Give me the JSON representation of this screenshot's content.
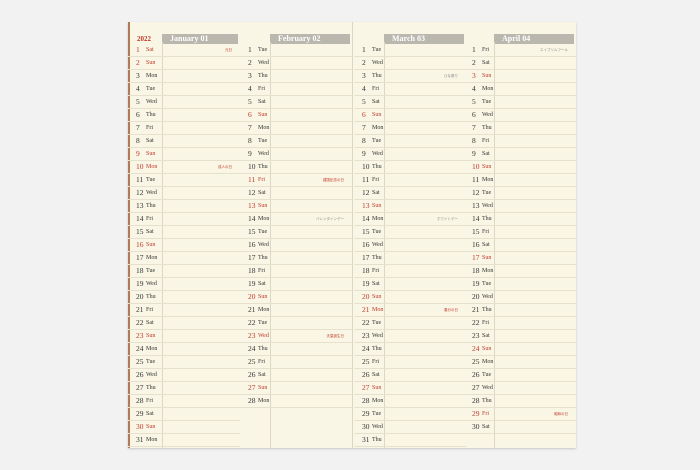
{
  "year": "2022",
  "colors": {
    "red": "#c0392b",
    "header_gray": "#b9b7ae",
    "paper": "#f9f6e5",
    "binding": "#b07b58"
  },
  "months": [
    {
      "title": "January 01",
      "days": [
        {
          "d": "1",
          "w": "Sat",
          "red": true,
          "note": "元日"
        },
        {
          "d": "2",
          "w": "Sun",
          "red": true
        },
        {
          "d": "3",
          "w": "Mon"
        },
        {
          "d": "4",
          "w": "Tue"
        },
        {
          "d": "5",
          "w": "Wed"
        },
        {
          "d": "6",
          "w": "Thu"
        },
        {
          "d": "7",
          "w": "Fri"
        },
        {
          "d": "8",
          "w": "Sat"
        },
        {
          "d": "9",
          "w": "Sun",
          "red": true
        },
        {
          "d": "10",
          "w": "Mon",
          "red": true,
          "note": "成人の日"
        },
        {
          "d": "11",
          "w": "Tue"
        },
        {
          "d": "12",
          "w": "Wed"
        },
        {
          "d": "13",
          "w": "Thu"
        },
        {
          "d": "14",
          "w": "Fri"
        },
        {
          "d": "15",
          "w": "Sat"
        },
        {
          "d": "16",
          "w": "Sun",
          "red": true
        },
        {
          "d": "17",
          "w": "Mon"
        },
        {
          "d": "18",
          "w": "Tue"
        },
        {
          "d": "19",
          "w": "Wed"
        },
        {
          "d": "20",
          "w": "Thu"
        },
        {
          "d": "21",
          "w": "Fri"
        },
        {
          "d": "22",
          "w": "Sat"
        },
        {
          "d": "23",
          "w": "Sun",
          "red": true
        },
        {
          "d": "24",
          "w": "Mon"
        },
        {
          "d": "25",
          "w": "Tue"
        },
        {
          "d": "26",
          "w": "Wed"
        },
        {
          "d": "27",
          "w": "Thu"
        },
        {
          "d": "28",
          "w": "Fri"
        },
        {
          "d": "29",
          "w": "Sat"
        },
        {
          "d": "30",
          "w": "Sun",
          "red": true
        },
        {
          "d": "31",
          "w": "Mon"
        }
      ]
    },
    {
      "title": "February 02",
      "days": [
        {
          "d": "1",
          "w": "Tue"
        },
        {
          "d": "2",
          "w": "Wed"
        },
        {
          "d": "3",
          "w": "Thu"
        },
        {
          "d": "4",
          "w": "Fri"
        },
        {
          "d": "5",
          "w": "Sat"
        },
        {
          "d": "6",
          "w": "Sun",
          "red": true
        },
        {
          "d": "7",
          "w": "Mon"
        },
        {
          "d": "8",
          "w": "Tue"
        },
        {
          "d": "9",
          "w": "Wed"
        },
        {
          "d": "10",
          "w": "Thu"
        },
        {
          "d": "11",
          "w": "Fri",
          "red": true,
          "note": "建国記念の日"
        },
        {
          "d": "12",
          "w": "Sat"
        },
        {
          "d": "13",
          "w": "Sun",
          "red": true
        },
        {
          "d": "14",
          "w": "Mon",
          "note": "バレンタインデー",
          "gray": true
        },
        {
          "d": "15",
          "w": "Tue"
        },
        {
          "d": "16",
          "w": "Wed"
        },
        {
          "d": "17",
          "w": "Thu"
        },
        {
          "d": "18",
          "w": "Fri"
        },
        {
          "d": "19",
          "w": "Sat"
        },
        {
          "d": "20",
          "w": "Sun",
          "red": true
        },
        {
          "d": "21",
          "w": "Mon"
        },
        {
          "d": "22",
          "w": "Tue"
        },
        {
          "d": "23",
          "w": "Wed",
          "red": true,
          "note": "天皇誕生日"
        },
        {
          "d": "24",
          "w": "Thu"
        },
        {
          "d": "25",
          "w": "Fri"
        },
        {
          "d": "26",
          "w": "Sat"
        },
        {
          "d": "27",
          "w": "Sun",
          "red": true
        },
        {
          "d": "28",
          "w": "Mon"
        }
      ]
    },
    {
      "title": "March 03",
      "days": [
        {
          "d": "1",
          "w": "Tue"
        },
        {
          "d": "2",
          "w": "Wed"
        },
        {
          "d": "3",
          "w": "Thu",
          "note": "ひな祭り",
          "gray": true
        },
        {
          "d": "4",
          "w": "Fri"
        },
        {
          "d": "5",
          "w": "Sat"
        },
        {
          "d": "6",
          "w": "Sun",
          "red": true
        },
        {
          "d": "7",
          "w": "Mon"
        },
        {
          "d": "8",
          "w": "Tue"
        },
        {
          "d": "9",
          "w": "Wed"
        },
        {
          "d": "10",
          "w": "Thu"
        },
        {
          "d": "11",
          "w": "Fri"
        },
        {
          "d": "12",
          "w": "Sat"
        },
        {
          "d": "13",
          "w": "Sun",
          "red": true
        },
        {
          "d": "14",
          "w": "Mon",
          "note": "ホワイトデー",
          "gray": true
        },
        {
          "d": "15",
          "w": "Tue"
        },
        {
          "d": "16",
          "w": "Wed"
        },
        {
          "d": "17",
          "w": "Thu"
        },
        {
          "d": "18",
          "w": "Fri"
        },
        {
          "d": "19",
          "w": "Sat"
        },
        {
          "d": "20",
          "w": "Sun",
          "red": true
        },
        {
          "d": "21",
          "w": "Mon",
          "red": true,
          "note": "春分の日"
        },
        {
          "d": "22",
          "w": "Tue"
        },
        {
          "d": "23",
          "w": "Wed"
        },
        {
          "d": "24",
          "w": "Thu"
        },
        {
          "d": "25",
          "w": "Fri"
        },
        {
          "d": "26",
          "w": "Sat"
        },
        {
          "d": "27",
          "w": "Sun",
          "red": true
        },
        {
          "d": "28",
          "w": "Mon"
        },
        {
          "d": "29",
          "w": "Tue"
        },
        {
          "d": "30",
          "w": "Wed"
        },
        {
          "d": "31",
          "w": "Thu"
        }
      ]
    },
    {
      "title": "April 04",
      "days": [
        {
          "d": "1",
          "w": "Fri",
          "note": "エイプリルフール",
          "gray": true
        },
        {
          "d": "2",
          "w": "Sat"
        },
        {
          "d": "3",
          "w": "Sun",
          "red": true
        },
        {
          "d": "4",
          "w": "Mon"
        },
        {
          "d": "5",
          "w": "Tue"
        },
        {
          "d": "6",
          "w": "Wed"
        },
        {
          "d": "7",
          "w": "Thu"
        },
        {
          "d": "8",
          "w": "Fri"
        },
        {
          "d": "9",
          "w": "Sat"
        },
        {
          "d": "10",
          "w": "Sun",
          "red": true
        },
        {
          "d": "11",
          "w": "Mon"
        },
        {
          "d": "12",
          "w": "Tue"
        },
        {
          "d": "13",
          "w": "Wed"
        },
        {
          "d": "14",
          "w": "Thu"
        },
        {
          "d": "15",
          "w": "Fri"
        },
        {
          "d": "16",
          "w": "Sat"
        },
        {
          "d": "17",
          "w": "Sun",
          "red": true
        },
        {
          "d": "18",
          "w": "Mon"
        },
        {
          "d": "19",
          "w": "Tue"
        },
        {
          "d": "20",
          "w": "Wed"
        },
        {
          "d": "21",
          "w": "Thu"
        },
        {
          "d": "22",
          "w": "Fri"
        },
        {
          "d": "23",
          "w": "Sat"
        },
        {
          "d": "24",
          "w": "Sun",
          "red": true
        },
        {
          "d": "25",
          "w": "Mon"
        },
        {
          "d": "26",
          "w": "Tue"
        },
        {
          "d": "27",
          "w": "Wed"
        },
        {
          "d": "28",
          "w": "Thu"
        },
        {
          "d": "29",
          "w": "Fri",
          "red": true,
          "note": "昭和の日"
        },
        {
          "d": "30",
          "w": "Sat"
        }
      ]
    }
  ]
}
